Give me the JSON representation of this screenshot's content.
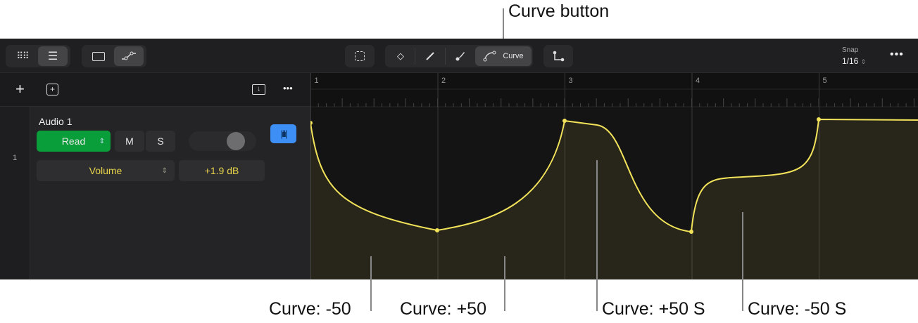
{
  "callouts": {
    "curve_button": "Curve button",
    "c1": "Curve: -50",
    "c2": "Curve: +50",
    "c3": "Curve: +50 S",
    "c4": "Curve: -50 S"
  },
  "toolbar": {
    "curve_label": "Curve",
    "snap_label": "Snap",
    "snap_value": "1/16"
  },
  "track": {
    "number": "1",
    "name": "Audio 1",
    "automation_mode": "Read",
    "mute": "M",
    "solo": "S",
    "parameter": "Volume",
    "value": "+1.9 dB"
  },
  "ruler": {
    "bars": [
      "1",
      "2",
      "3",
      "4",
      "5"
    ]
  },
  "colors": {
    "curve": "#f2e35a",
    "read": "#0a9e3a",
    "accent": "#3d8ff5"
  }
}
